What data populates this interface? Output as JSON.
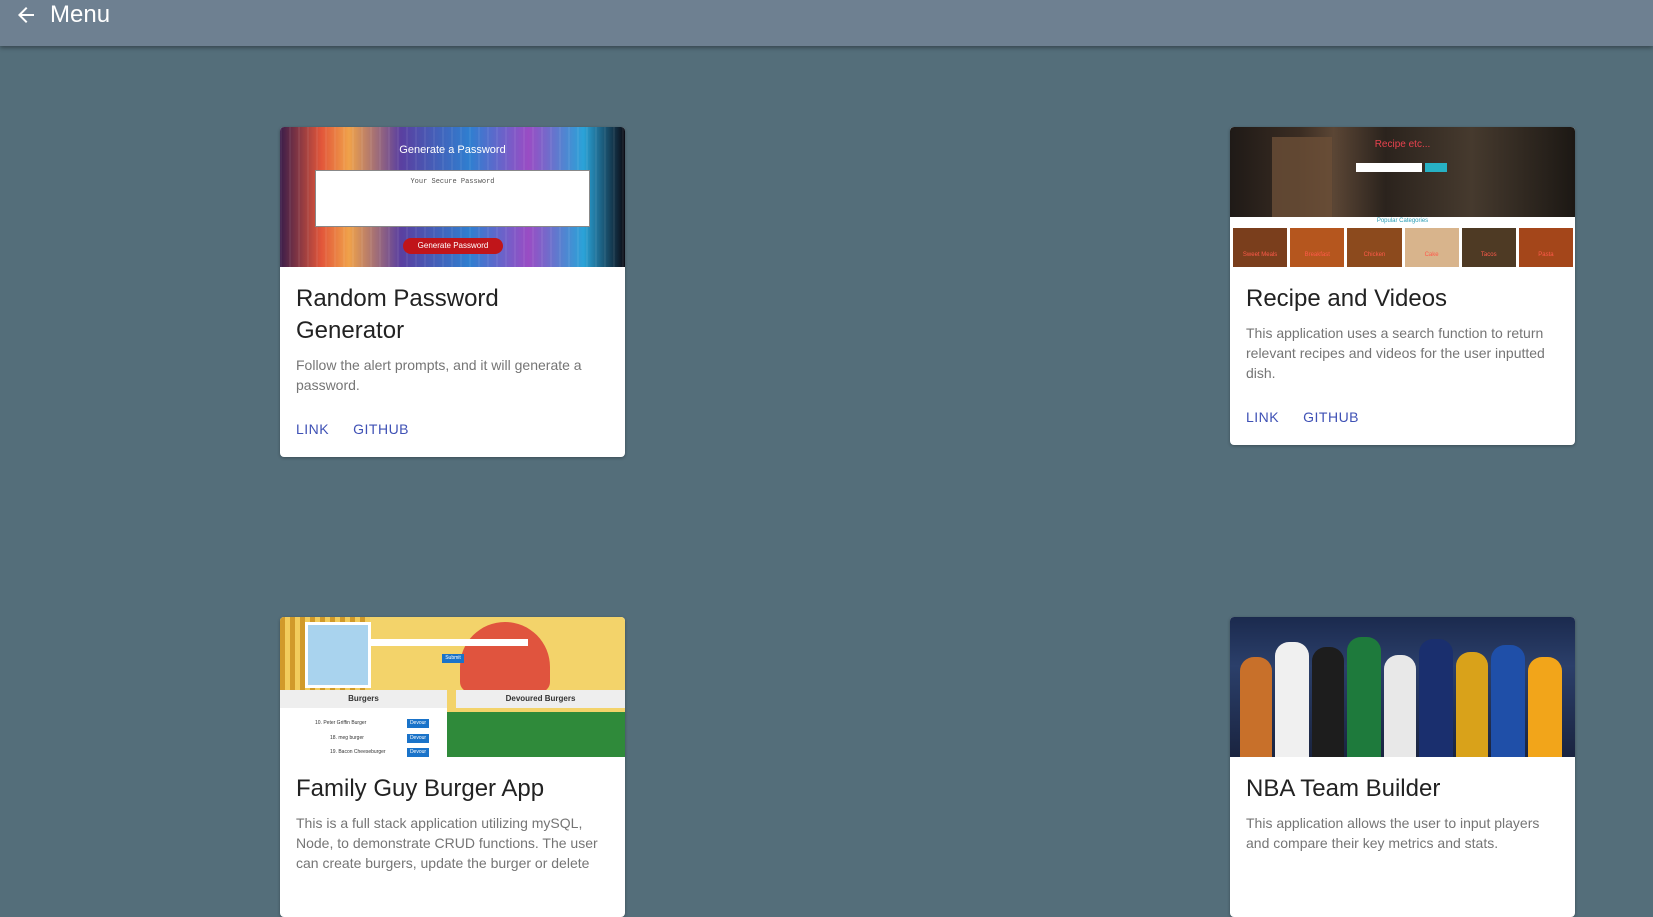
{
  "appbar": {
    "title": "Menu",
    "back_icon": "arrow-left-icon"
  },
  "colors": {
    "background": "#546e7a",
    "appbar": "#6e8091",
    "button": "#3f51b5"
  },
  "cards": [
    {
      "title": "Random Password Generator",
      "description": "Follow the alert prompts, and it will generate a password.",
      "link_label": "LINK",
      "github_label": "GITHUB",
      "preview": {
        "heading": "Generate a Password",
        "placeholder": "Your Secure Password",
        "button": "Generate Password"
      }
    },
    {
      "title": "Recipe and Videos",
      "description": "This application uses a search function to return relevant recipes and videos for the user inputted dish.",
      "link_label": "LINK",
      "github_label": "GITHUB",
      "preview": {
        "heading": "Recipe etc...",
        "subheading": "Popular Categories",
        "categories": [
          "Sweet Meals",
          "Breakfast",
          "Chicken",
          "Cake",
          "Tacos",
          "Pasta"
        ]
      }
    },
    {
      "title": "Family Guy Burger App",
      "description": "This is a full stack application utilizing mySQL, Node, to demonstrate CRUD functions. The user can create burgers, update the burger or delete",
      "preview": {
        "col1": "Burgers",
        "col2": "Devoured Burgers",
        "submit": "Submit",
        "items": [
          "10. Peter Griffin Burger",
          "18. meg burger",
          "19. Bacon Cheeseburger"
        ],
        "item_button": "Devour"
      }
    },
    {
      "title": "NBA Team Builder",
      "description": "This application allows the user to input players and compare their key metrics and stats."
    }
  ]
}
